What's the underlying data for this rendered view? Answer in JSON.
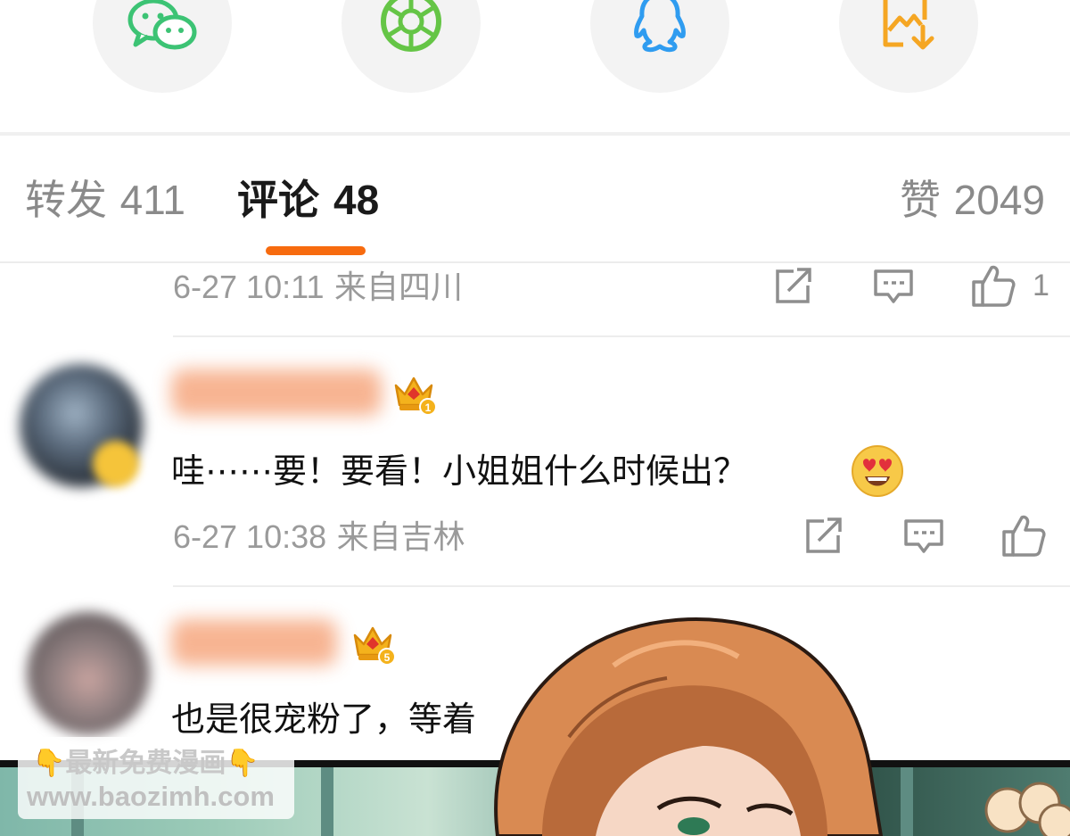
{
  "share": {
    "items": [
      {
        "icon": "wechat-icon",
        "color": "#3cc374"
      },
      {
        "icon": "moments-icon",
        "color": "#65c546"
      },
      {
        "icon": "qq-icon",
        "color": "#2f9cf0"
      },
      {
        "icon": "save-image-icon",
        "color": "#f5a623"
      }
    ]
  },
  "tabs": {
    "forward": {
      "label": "转发",
      "count": "411"
    },
    "comments": {
      "label": "评论",
      "count": "48"
    },
    "likes": {
      "label": "赞",
      "count": "2049"
    },
    "active": "comments",
    "accent": "#f76b0f"
  },
  "comments": [
    {
      "time": "6-27 10:11",
      "location": "来自四川",
      "like_count": "1"
    },
    {
      "time": "6-27 10:38",
      "location": "来自吉林",
      "text": "哇⋯⋯要！要看！小姐姐什么时候出？",
      "emoji": "heart-eyes-emoji",
      "badge_level": "1"
    },
    {
      "text": "也是很宠粉了，等着",
      "badge_level": "5"
    }
  ],
  "watermark": {
    "line1": "最新免费漫画",
    "line2": "www.baozimh.com"
  }
}
